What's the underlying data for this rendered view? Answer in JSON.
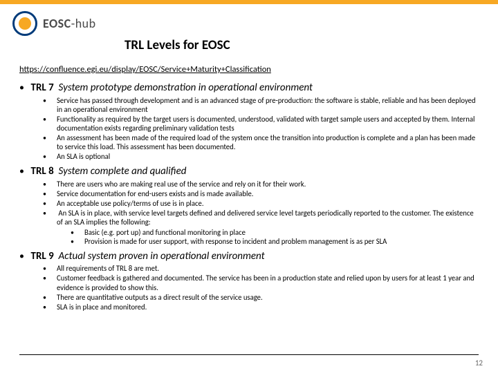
{
  "logo": {
    "bold": "EOSC",
    "thin": "-hub"
  },
  "title": "TRL Levels for EOSC",
  "link": "https://confluence.egi.eu/display/EOSC/Service+Maturity+Classification",
  "trl7": {
    "label": "TRL 7",
    "desc": "System prototype demonstration in operational environment",
    "bullets": [
      "Service has passed through development and is an advanced stage of pre-production: the software is stable, reliable and has been deployed in an operational environment",
      "Functionality as required by the target users is documented, understood, validated with target sample users and accepted by them. Internal documentation exists regarding preliminary validation tests",
      "An assessment has been made of the required load of the system once the transition into production is complete and a plan has been made to service this load. This assessment has been documented.",
      "An SLA is optional"
    ]
  },
  "trl8": {
    "label": "TRL 8",
    "desc": "System complete and qualified",
    "bullets": [
      "There are users who are making real use of the service and rely on it for their work.",
      "Service documentation for end-users exists and is made available.",
      "An acceptable use policy/terms of use is in place.",
      "An SLA is in place, with service level targets defined and delivered service level targets periodically reported to the customer. The existence of an SLA implies the following:"
    ],
    "subbullets": [
      "Basic (e.g. port up) and functional monitoring in place",
      "Provision is made for user support, with response to incident and problem management is as per SLA"
    ]
  },
  "trl9": {
    "label": "TRL 9",
    "desc": "Actual system proven in operational environment",
    "bullets": [
      "All requirements of TRL 8 are met.",
      "Customer feedback is gathered and documented. The service has been in a production state and relied upon by users for at least 1 year and evidence is provided to show this.",
      "There are quantitative outputs as a direct result of the service usage.",
      "SLA is in place and monitored."
    ]
  },
  "page": "12"
}
